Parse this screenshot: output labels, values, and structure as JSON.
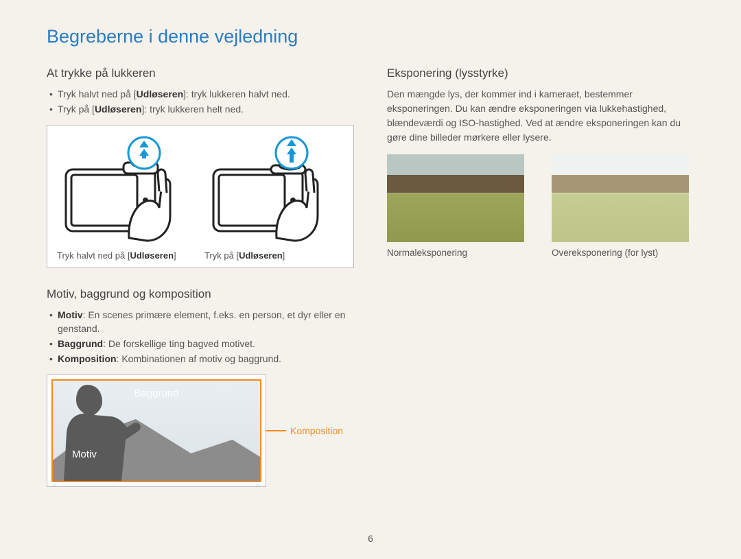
{
  "page_title": "Begreberne i denne vejledning",
  "page_number": "6",
  "left": {
    "section1": {
      "heading": "At trykke på lukkeren",
      "bullet1_pre": "Tryk halvt ned på [",
      "bullet1_bold": "Udløseren",
      "bullet1_post": "]: tryk lukkeren halvt ned.",
      "bullet2_pre": "Tryk på [",
      "bullet2_bold": "Udløseren",
      "bullet2_post": "]: tryk lukkeren helt ned.",
      "caption1_pre": "Tryk halvt ned på [",
      "caption1_bold": "Udløseren",
      "caption1_post": "]",
      "caption2_pre": "Tryk på [",
      "caption2_bold": "Udløseren",
      "caption2_post": "]"
    },
    "section2": {
      "heading": "Motiv, baggrund og komposition",
      "bullet1_bold": "Motiv",
      "bullet1_text": ": En scenes primære element, f.eks. en person, et dyr eller en genstand.",
      "bullet2_bold": "Baggrund",
      "bullet2_text": ": De forskellige ting bagved motivet.",
      "bullet3_bold": "Komposition",
      "bullet3_text": ": Kombinationen af motiv og baggrund.",
      "label_baggrund": "Baggrund",
      "label_motiv": "Motiv",
      "label_komposition": "Komposition"
    }
  },
  "right": {
    "section1": {
      "heading": "Eksponering (lysstyrke)",
      "paragraph": "Den mængde lys, der kommer ind i kameraet, bestemmer eksponeringen. Du kan ændre eksponeringen via lukkehastighed, blændeværdi og ISO-hastighed. Ved at ændre eksponeringen kan du gøre dine billeder mørkere eller lysere.",
      "caption_normal": "Normaleksponering",
      "caption_over": "Overeksponering (for lyst)"
    }
  }
}
